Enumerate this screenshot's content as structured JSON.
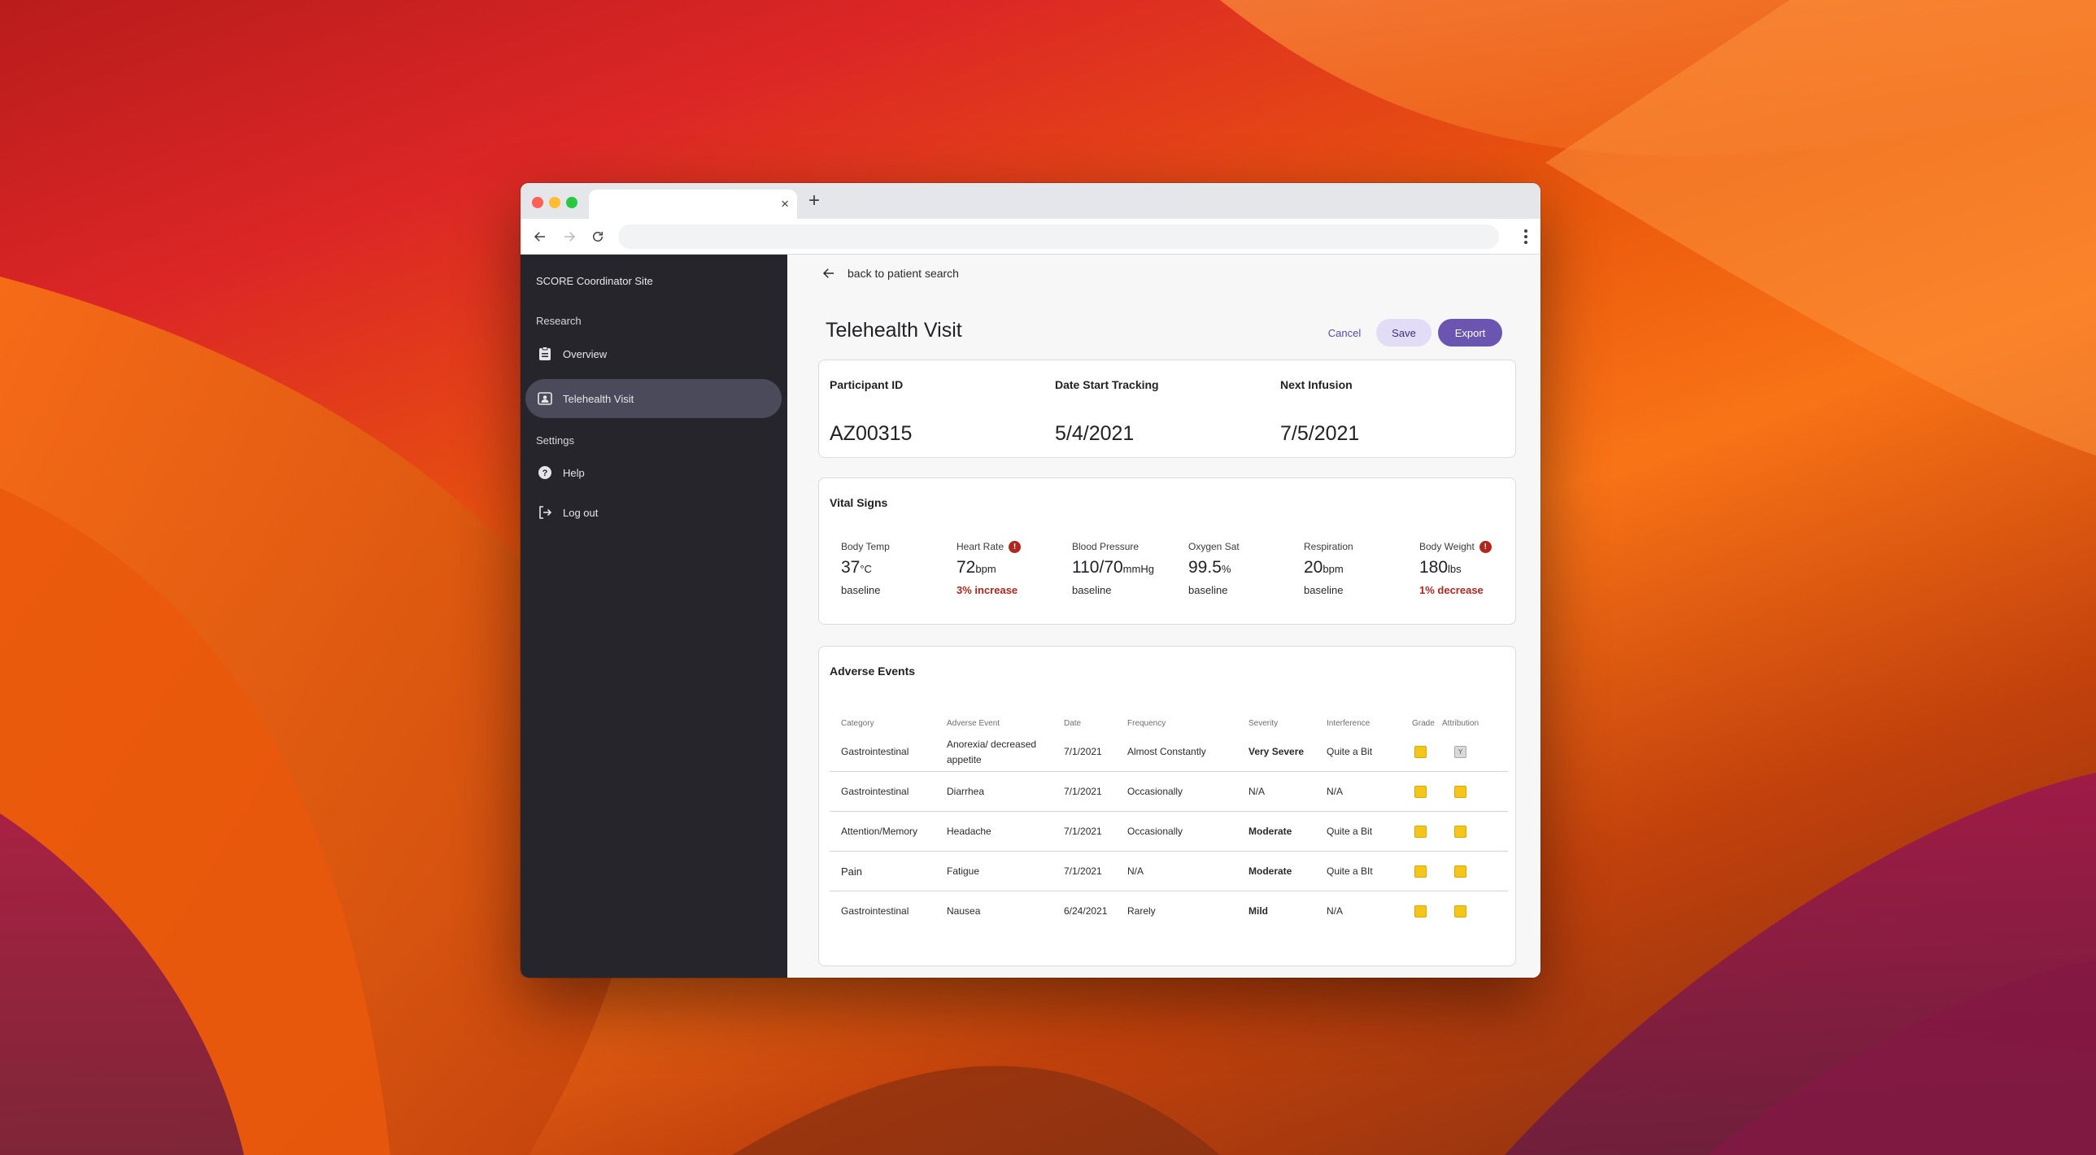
{
  "browser": {
    "tab_close": "×",
    "new_tab": "+"
  },
  "sidebar": {
    "site": "SCORE Coordinator Site",
    "sections": [
      "Research",
      "Settings"
    ],
    "items": [
      {
        "label": "Overview",
        "icon": "clipboard-icon"
      },
      {
        "label": "Telehealth Visit",
        "icon": "contact-card-icon",
        "active": true
      },
      {
        "label": "Help",
        "icon": "help-circle-icon"
      },
      {
        "label": "Log out",
        "icon": "logout-icon"
      }
    ]
  },
  "header": {
    "back_label": "back to patient search",
    "title": "Telehealth Visit",
    "cancel": "Cancel",
    "save": "Save",
    "export": "Export"
  },
  "participant": {
    "labels": [
      "Participant ID",
      "Date Start Tracking",
      "Next Infusion"
    ],
    "values": [
      "AZ00315",
      "5/4/2021",
      "7/5/2021"
    ]
  },
  "vitals": {
    "title": "Vital Signs",
    "items": [
      {
        "label": "Body Temp",
        "value": "37",
        "unit": "°C",
        "status": "baseline",
        "alert": false
      },
      {
        "label": "Heart Rate",
        "value": "72",
        "unit": "bpm",
        "status": "3% increase",
        "alert": true
      },
      {
        "label": "Blood Pressure",
        "value": "110/70",
        "unit": "mmHg",
        "status": "baseline",
        "alert": false
      },
      {
        "label": "Oxygen Sat",
        "value": "99.5",
        "unit": "%",
        "status": "baseline",
        "alert": false
      },
      {
        "label": "Respiration",
        "value": "20",
        "unit": "bpm",
        "status": "baseline",
        "alert": false
      },
      {
        "label": "Body Weight",
        "value": "180",
        "unit": "lbs",
        "status": "1% decrease",
        "alert": true
      }
    ],
    "alert_glyph": "!"
  },
  "adverse_events": {
    "title": "Adverse Events",
    "columns": [
      "Category",
      "Adverse Event",
      "Date",
      "Frequency",
      "Severity",
      "Interference",
      "Grade",
      "Attribution"
    ],
    "rows": [
      {
        "category": "Gastrointestinal",
        "event": "Anorexia/ decreased appetite",
        "date": "7/1/2021",
        "frequency": "Almost Constantly",
        "severity": "Very Severe",
        "interference": "Quite a Bit",
        "attribution_text": "Y"
      },
      {
        "category": "Gastrointestinal",
        "event": "Diarrhea",
        "date": "7/1/2021",
        "frequency": "Occasionally",
        "severity": "N/A",
        "interference": "N/A"
      },
      {
        "category": "Attention/Memory",
        "event": "Headache",
        "date": "7/1/2021",
        "frequency": "Occasionally",
        "severity": "Moderate",
        "interference": "Quite a Bit"
      },
      {
        "category": "Pain",
        "event": "Fatigue",
        "date": "7/1/2021",
        "frequency": "N/A",
        "severity": "Moderate",
        "interference": "Quite a BIt"
      },
      {
        "category": "Gastrointestinal",
        "event": "Nausea",
        "date": "6/24/2021",
        "frequency": "Rarely",
        "severity": "Mild",
        "interference": "N/A"
      }
    ]
  },
  "colors": {
    "accent": "#6a55b0",
    "sidebar": "#25252b",
    "alert": "#b3261e",
    "grade": "#f5c518"
  }
}
